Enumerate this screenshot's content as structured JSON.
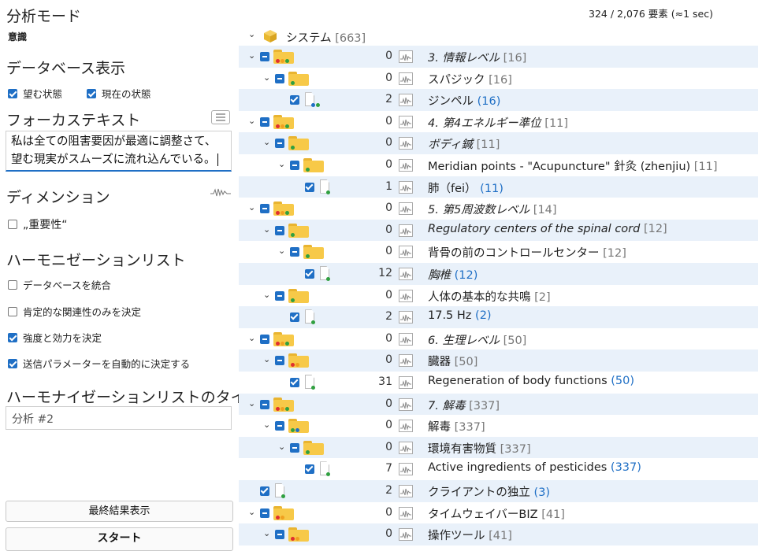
{
  "left": {
    "mode_title": "分析モード",
    "mode_value": "意識",
    "db_title": "データベース表示",
    "db_checks": [
      {
        "label": "望む状態",
        "checked": true
      },
      {
        "label": "現在の状態",
        "checked": true
      }
    ],
    "focus_title": "フォーカステキスト",
    "focus_text_line1": "私は全ての阻害要因が最適に調整さて、",
    "focus_text_line2": "望む現実がスムーズに流れ込んでいる。",
    "dim_title": "ディメンション",
    "dim_check": {
      "label": "„重要性“",
      "checked": false
    },
    "harm_title": "ハーモニゼーションリスト",
    "harm_checks": [
      {
        "label": "データベースを統合",
        "checked": false
      },
      {
        "label": "肯定的な関連性のみを決定",
        "checked": false
      },
      {
        "label": "強度と効力を決定",
        "checked": true
      },
      {
        "label": "送信パラメーターを自動的に決定する",
        "checked": true
      }
    ],
    "list_title_label": "ハーモナイゼーションリストのタイトル",
    "list_title_value": "分析 #2",
    "final_button": "最終結果表示",
    "start_button": "スタート"
  },
  "right": {
    "status": "324 / 2,076 要素 (≈1 sec)",
    "root": {
      "label": "システム",
      "suffix": "[663]"
    },
    "rows": [
      {
        "level": 1,
        "kind": "folder",
        "dots": [
          "#e03030",
          "#f0a020",
          "#30a040"
        ],
        "count": "0",
        "label": "3. 情報レベル",
        "italic": true,
        "suffix": "[16]",
        "blue": false
      },
      {
        "level": 2,
        "kind": "folder",
        "dots": [
          "#30a040"
        ],
        "count": "0",
        "label": "スパジック",
        "italic": false,
        "suffix": "[16]",
        "blue": false
      },
      {
        "level": 3,
        "kind": "doc",
        "dots": [
          "#1f6fc5",
          "#30a040"
        ],
        "count": "2",
        "label": "ジンペル",
        "italic": false,
        "suffix": "(16)",
        "blue": true
      },
      {
        "level": 1,
        "kind": "folder",
        "dots": [
          "#e03030",
          "#f0a020",
          "#30a040"
        ],
        "count": "0",
        "label": "4. 第4エネルギー準位",
        "italic": true,
        "suffix": "[11]",
        "blue": false
      },
      {
        "level": 2,
        "kind": "folder",
        "dots": [
          "#30a040"
        ],
        "count": "0",
        "label": "ボディ鍼",
        "italic": true,
        "suffix": "[11]",
        "blue": false
      },
      {
        "level": 3,
        "kind": "folder",
        "dots": [
          "#30a040"
        ],
        "count": "0",
        "label": "Meridian points - \"Acupuncture\" 針灸 (zhenjiu)",
        "italic": false,
        "suffix": "[11]",
        "blue": false
      },
      {
        "level": 4,
        "kind": "doc",
        "dots": [
          "#30a040"
        ],
        "count": "1",
        "label": "肺（fei）",
        "italic": false,
        "suffix": "(11)",
        "blue": true
      },
      {
        "level": 1,
        "kind": "folder",
        "dots": [
          "#e03030",
          "#f0a020",
          "#30a040"
        ],
        "count": "0",
        "label": "5. 第5周波数レベル",
        "italic": true,
        "suffix": "[14]",
        "blue": false
      },
      {
        "level": 2,
        "kind": "folder",
        "dots": [
          "#30a040"
        ],
        "count": "0",
        "label": "Regulatory centers of the spinal cord",
        "italic": true,
        "suffix": "[12]",
        "blue": false
      },
      {
        "level": 3,
        "kind": "folder",
        "dots": [
          "#30a040"
        ],
        "count": "0",
        "label": "背骨の前のコントロールセンター",
        "italic": false,
        "suffix": "[12]",
        "blue": false
      },
      {
        "level": 4,
        "kind": "doc",
        "dots": [
          "#30a040"
        ],
        "count": "12",
        "label": "胸椎",
        "italic": true,
        "suffix": "(12)",
        "blue": true
      },
      {
        "level": 2,
        "kind": "folder",
        "dots": [
          "#30a040"
        ],
        "count": "0",
        "label": "人体の基本的な共鳴",
        "italic": false,
        "suffix": "[2]",
        "blue": false
      },
      {
        "level": 3,
        "kind": "doc",
        "dots": [
          "#30a040"
        ],
        "count": "2",
        "label": "17.5 Hz",
        "italic": false,
        "suffix": "(2)",
        "blue": true
      },
      {
        "level": 1,
        "kind": "folder",
        "dots": [
          "#e03030",
          "#f0a020",
          "#30a040"
        ],
        "count": "0",
        "label": "6. 生理レベル",
        "italic": true,
        "suffix": "[50]",
        "blue": false
      },
      {
        "level": 2,
        "kind": "folder",
        "dots": [
          "#e03030",
          "#f0a020"
        ],
        "count": "0",
        "label": "臓器",
        "italic": false,
        "suffix": "[50]",
        "blue": false
      },
      {
        "level": 3,
        "kind": "doc",
        "dots": [
          "#30a040"
        ],
        "count": "31",
        "label": "Regeneration of body functions",
        "italic": false,
        "suffix": "(50)",
        "blue": true
      },
      {
        "level": 1,
        "kind": "folder",
        "dots": [
          "#e03030",
          "#f0a020",
          "#30a040"
        ],
        "count": "0",
        "label": "7. 解毒",
        "italic": true,
        "suffix": "[337]",
        "blue": false
      },
      {
        "level": 2,
        "kind": "folder",
        "dots": [
          "#30a040",
          "#1f6fc5"
        ],
        "count": "0",
        "label": "解毒",
        "italic": false,
        "suffix": "[337]",
        "blue": false
      },
      {
        "level": 3,
        "kind": "folder",
        "dots": [
          "#30a040"
        ],
        "count": "0",
        "label": "環境有害物質",
        "italic": false,
        "suffix": "[337]",
        "blue": false
      },
      {
        "level": 4,
        "kind": "doc",
        "dots": [
          "#30a040"
        ],
        "count": "7",
        "label": "Active ingredients of pesticides",
        "italic": false,
        "suffix": "(337)",
        "blue": true
      },
      {
        "level": 1,
        "kind": "doc",
        "dots": [
          "#30a040"
        ],
        "count": "2",
        "label": "クライアントの独立",
        "italic": false,
        "suffix": "(3)",
        "blue": true
      },
      {
        "level": 1,
        "kind": "folder",
        "dots": [
          "#e03030",
          "#f0a020"
        ],
        "count": "0",
        "label": "タイムウェイバーBIZ",
        "italic": false,
        "suffix": "[41]",
        "blue": false
      },
      {
        "level": 2,
        "kind": "folder",
        "dots": [
          "#e03030",
          "#f0a020"
        ],
        "count": "0",
        "label": "操作ツール",
        "italic": false,
        "suffix": "[41]",
        "blue": false
      }
    ]
  }
}
